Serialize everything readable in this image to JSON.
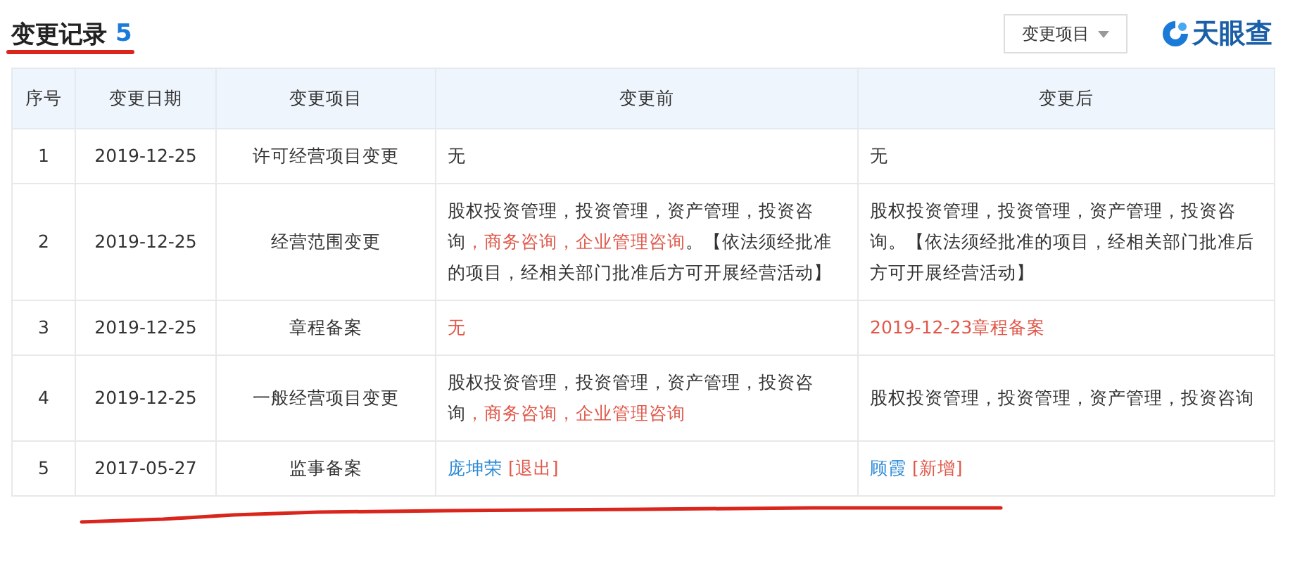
{
  "header": {
    "title": "变更记录",
    "count": "5",
    "filter_button": "变更项目",
    "logo": "天眼查"
  },
  "table": {
    "columns": [
      "序号",
      "变更日期",
      "变更项目",
      "变更前",
      "变更后"
    ],
    "rows": [
      {
        "index": "1",
        "date": "2019-12-25",
        "item": "许可经营项目变更",
        "before": [
          {
            "kind": "plain",
            "text": "无"
          }
        ],
        "after": [
          {
            "kind": "plain",
            "text": "无"
          }
        ]
      },
      {
        "index": "2",
        "date": "2019-12-25",
        "item": "经营范围变更",
        "before": [
          {
            "kind": "plain",
            "text": "股权投资管理，投资管理，资产管理，投资咨询"
          },
          {
            "kind": "changed",
            "text": "，商务咨询，企业管理咨询"
          },
          {
            "kind": "plain",
            "text": "。【依法须经批准的项目，经相关部门批准后方可开展经营活动】"
          }
        ],
        "after": [
          {
            "kind": "plain",
            "text": "股权投资管理，投资管理，资产管理，投资咨询。【依法须经批准的项目，经相关部门批准后方可开展经营活动】"
          }
        ]
      },
      {
        "index": "3",
        "date": "2019-12-25",
        "item": "章程备案",
        "before": [
          {
            "kind": "changed",
            "text": "无"
          }
        ],
        "after": [
          {
            "kind": "changed",
            "text": "2019-12-23章程备案"
          }
        ]
      },
      {
        "index": "4",
        "date": "2019-12-25",
        "item": "一般经营项目变更",
        "before": [
          {
            "kind": "plain",
            "text": "股权投资管理，投资管理，资产管理，投资咨询"
          },
          {
            "kind": "changed",
            "text": "，商务咨询，企业管理咨询"
          }
        ],
        "after": [
          {
            "kind": "plain",
            "text": "股权投资管理，投资管理，资产管理，投资咨询"
          }
        ]
      },
      {
        "index": "5",
        "date": "2017-05-27",
        "item": "监事备案",
        "before": [
          {
            "kind": "person",
            "text": "庞坤荣"
          },
          {
            "kind": "changed",
            "text": " [退出]"
          }
        ],
        "after": [
          {
            "kind": "person",
            "text": "顾霞"
          },
          {
            "kind": "changed",
            "text": " [新增]"
          }
        ]
      }
    ]
  }
}
